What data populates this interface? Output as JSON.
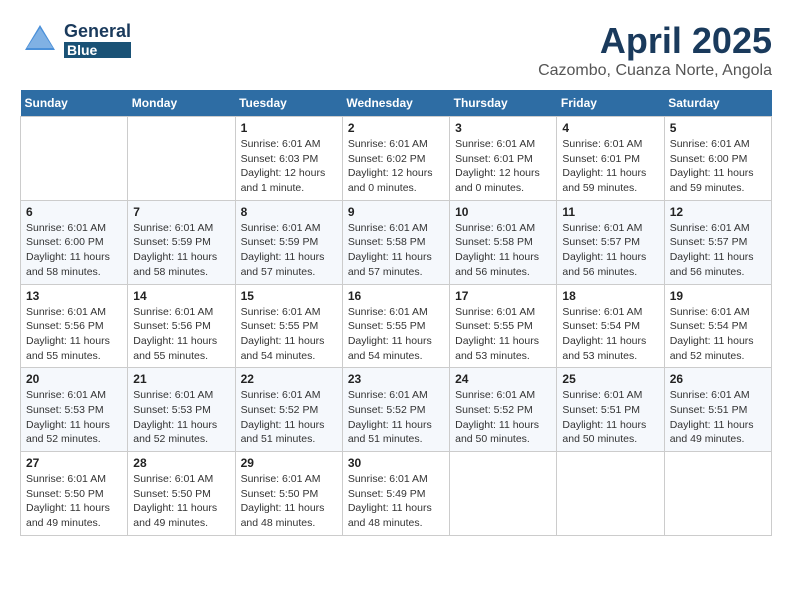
{
  "header": {
    "logo_general": "General",
    "logo_blue": "Blue",
    "month": "April 2025",
    "location": "Cazombo, Cuanza Norte, Angola"
  },
  "days_of_week": [
    "Sunday",
    "Monday",
    "Tuesday",
    "Wednesday",
    "Thursday",
    "Friday",
    "Saturday"
  ],
  "weeks": [
    [
      {
        "day": "",
        "detail": ""
      },
      {
        "day": "",
        "detail": ""
      },
      {
        "day": "1",
        "detail": "Sunrise: 6:01 AM\nSunset: 6:03 PM\nDaylight: 12 hours\nand 1 minute."
      },
      {
        "day": "2",
        "detail": "Sunrise: 6:01 AM\nSunset: 6:02 PM\nDaylight: 12 hours\nand 0 minutes."
      },
      {
        "day": "3",
        "detail": "Sunrise: 6:01 AM\nSunset: 6:01 PM\nDaylight: 12 hours\nand 0 minutes."
      },
      {
        "day": "4",
        "detail": "Sunrise: 6:01 AM\nSunset: 6:01 PM\nDaylight: 11 hours\nand 59 minutes."
      },
      {
        "day": "5",
        "detail": "Sunrise: 6:01 AM\nSunset: 6:00 PM\nDaylight: 11 hours\nand 59 minutes."
      }
    ],
    [
      {
        "day": "6",
        "detail": "Sunrise: 6:01 AM\nSunset: 6:00 PM\nDaylight: 11 hours\nand 58 minutes."
      },
      {
        "day": "7",
        "detail": "Sunrise: 6:01 AM\nSunset: 5:59 PM\nDaylight: 11 hours\nand 58 minutes."
      },
      {
        "day": "8",
        "detail": "Sunrise: 6:01 AM\nSunset: 5:59 PM\nDaylight: 11 hours\nand 57 minutes."
      },
      {
        "day": "9",
        "detail": "Sunrise: 6:01 AM\nSunset: 5:58 PM\nDaylight: 11 hours\nand 57 minutes."
      },
      {
        "day": "10",
        "detail": "Sunrise: 6:01 AM\nSunset: 5:58 PM\nDaylight: 11 hours\nand 56 minutes."
      },
      {
        "day": "11",
        "detail": "Sunrise: 6:01 AM\nSunset: 5:57 PM\nDaylight: 11 hours\nand 56 minutes."
      },
      {
        "day": "12",
        "detail": "Sunrise: 6:01 AM\nSunset: 5:57 PM\nDaylight: 11 hours\nand 56 minutes."
      }
    ],
    [
      {
        "day": "13",
        "detail": "Sunrise: 6:01 AM\nSunset: 5:56 PM\nDaylight: 11 hours\nand 55 minutes."
      },
      {
        "day": "14",
        "detail": "Sunrise: 6:01 AM\nSunset: 5:56 PM\nDaylight: 11 hours\nand 55 minutes."
      },
      {
        "day": "15",
        "detail": "Sunrise: 6:01 AM\nSunset: 5:55 PM\nDaylight: 11 hours\nand 54 minutes."
      },
      {
        "day": "16",
        "detail": "Sunrise: 6:01 AM\nSunset: 5:55 PM\nDaylight: 11 hours\nand 54 minutes."
      },
      {
        "day": "17",
        "detail": "Sunrise: 6:01 AM\nSunset: 5:55 PM\nDaylight: 11 hours\nand 53 minutes."
      },
      {
        "day": "18",
        "detail": "Sunrise: 6:01 AM\nSunset: 5:54 PM\nDaylight: 11 hours\nand 53 minutes."
      },
      {
        "day": "19",
        "detail": "Sunrise: 6:01 AM\nSunset: 5:54 PM\nDaylight: 11 hours\nand 52 minutes."
      }
    ],
    [
      {
        "day": "20",
        "detail": "Sunrise: 6:01 AM\nSunset: 5:53 PM\nDaylight: 11 hours\nand 52 minutes."
      },
      {
        "day": "21",
        "detail": "Sunrise: 6:01 AM\nSunset: 5:53 PM\nDaylight: 11 hours\nand 52 minutes."
      },
      {
        "day": "22",
        "detail": "Sunrise: 6:01 AM\nSunset: 5:52 PM\nDaylight: 11 hours\nand 51 minutes."
      },
      {
        "day": "23",
        "detail": "Sunrise: 6:01 AM\nSunset: 5:52 PM\nDaylight: 11 hours\nand 51 minutes."
      },
      {
        "day": "24",
        "detail": "Sunrise: 6:01 AM\nSunset: 5:52 PM\nDaylight: 11 hours\nand 50 minutes."
      },
      {
        "day": "25",
        "detail": "Sunrise: 6:01 AM\nSunset: 5:51 PM\nDaylight: 11 hours\nand 50 minutes."
      },
      {
        "day": "26",
        "detail": "Sunrise: 6:01 AM\nSunset: 5:51 PM\nDaylight: 11 hours\nand 49 minutes."
      }
    ],
    [
      {
        "day": "27",
        "detail": "Sunrise: 6:01 AM\nSunset: 5:50 PM\nDaylight: 11 hours\nand 49 minutes."
      },
      {
        "day": "28",
        "detail": "Sunrise: 6:01 AM\nSunset: 5:50 PM\nDaylight: 11 hours\nand 49 minutes."
      },
      {
        "day": "29",
        "detail": "Sunrise: 6:01 AM\nSunset: 5:50 PM\nDaylight: 11 hours\nand 48 minutes."
      },
      {
        "day": "30",
        "detail": "Sunrise: 6:01 AM\nSunset: 5:49 PM\nDaylight: 11 hours\nand 48 minutes."
      },
      {
        "day": "",
        "detail": ""
      },
      {
        "day": "",
        "detail": ""
      },
      {
        "day": "",
        "detail": ""
      }
    ]
  ]
}
